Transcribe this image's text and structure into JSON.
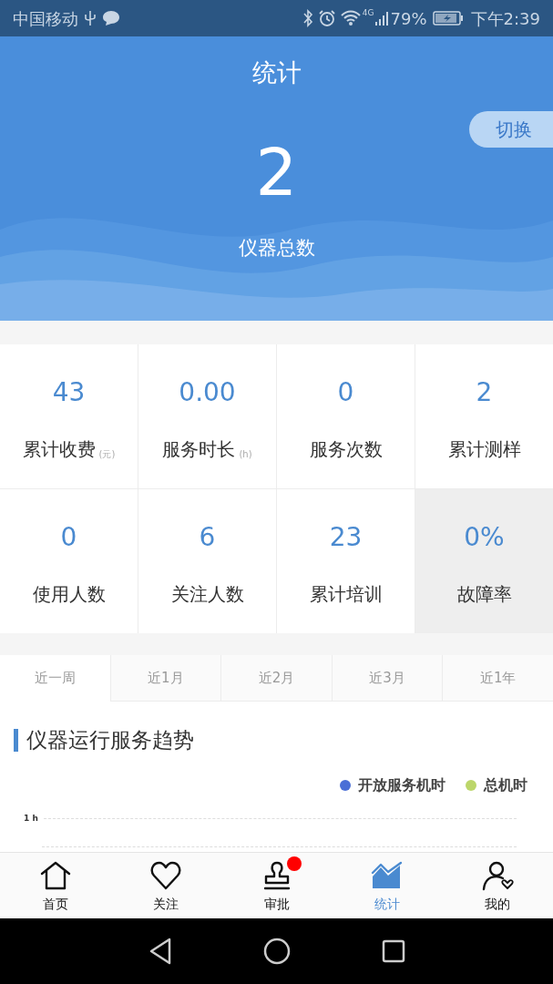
{
  "status_bar": {
    "carrier": "中国移动",
    "network": "4G",
    "battery": "79%",
    "time": "下午2:39"
  },
  "header": {
    "title": "统计",
    "switch_button": "切换",
    "total": "2",
    "total_label": "仪器总数"
  },
  "stats": [
    {
      "value": "43",
      "label": "累计收费",
      "unit": "(元)",
      "highlighted": false
    },
    {
      "value": "0.00",
      "label": "服务时长",
      "unit": "(h)",
      "highlighted": false
    },
    {
      "value": "0",
      "label": "服务次数",
      "highlighted": false
    },
    {
      "value": "2",
      "label": "累计测样",
      "highlighted": false
    },
    {
      "value": "0",
      "label": "使用人数",
      "highlighted": false
    },
    {
      "value": "6",
      "label": "关注人数",
      "highlighted": false
    },
    {
      "value": "23",
      "label": "累计培训",
      "highlighted": false
    },
    {
      "value": "0%",
      "label": "故障率",
      "highlighted": true
    }
  ],
  "period_tabs": [
    {
      "label": "近一周",
      "selected": true
    },
    {
      "label": "近1月",
      "selected": false
    },
    {
      "label": "近2月",
      "selected": false
    },
    {
      "label": "近3月",
      "selected": false
    },
    {
      "label": "近1年",
      "selected": false
    }
  ],
  "chart": {
    "title": "仪器运行服务趋势",
    "legend": [
      {
        "label": "开放服务机时",
        "color": "#4a6fd6"
      },
      {
        "label": "总机时",
        "color": "#bcd66a"
      }
    ],
    "y_tick": "1 h"
  },
  "bottom_nav": [
    {
      "label": "首页",
      "kind": "home",
      "selected": false,
      "badge": false
    },
    {
      "label": "关注",
      "kind": "heart",
      "selected": false,
      "badge": false
    },
    {
      "label": "审批",
      "kind": "stamp",
      "selected": false,
      "badge": true
    },
    {
      "label": "统计",
      "kind": "chart",
      "selected": true,
      "badge": false
    },
    {
      "label": "我的",
      "kind": "user",
      "selected": false,
      "badge": false
    }
  ]
}
